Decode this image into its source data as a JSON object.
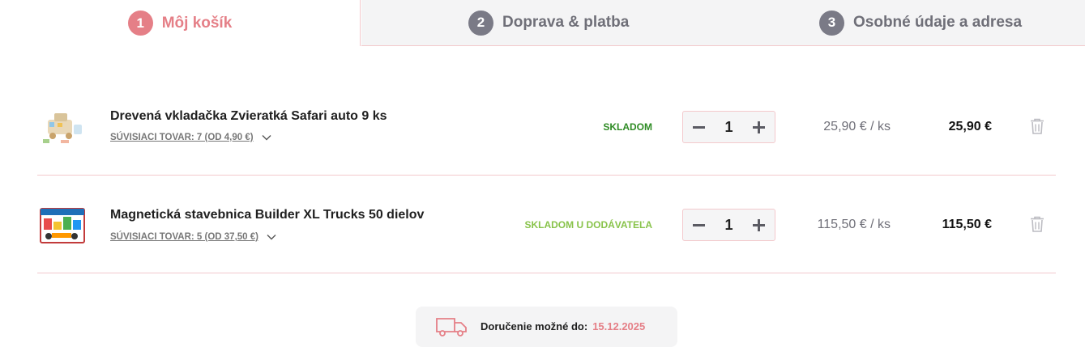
{
  "steps": [
    {
      "number": "1",
      "label": "Môj košík",
      "active": true
    },
    {
      "number": "2",
      "label": "Doprava & platba",
      "active": false
    },
    {
      "number": "3",
      "label": "Osobné údaje a adresa",
      "active": false
    }
  ],
  "colors": {
    "accent": "#e57f87",
    "step_inactive": "#7a7a86",
    "in_stock": "#2e8b24",
    "supplier_stock": "#88c34a",
    "divider": "#f3c9cc"
  },
  "items": [
    {
      "name": "Drevená vkladačka Zvieratká Safari auto 9 ks",
      "related": "SÚVISIACI TOVAR: 7 (OD 4,90 €)",
      "stock": "SKLADOM",
      "quantity": "1",
      "unit_price": "25,90 €  / ks",
      "total": "25,90 €"
    },
    {
      "name": "Magnetická stavebnica Builder XL Trucks 50 dielov",
      "related": "SÚVISIACI TOVAR: 5 (OD 37,50 €)",
      "stock": "SKLADOM U DODÁVATEĽA",
      "quantity": "1",
      "unit_price": "115,50 €  / ks",
      "total": "115,50 €"
    }
  ],
  "icons": {
    "qty_minus": "minus-icon",
    "qty_plus": "plus-icon",
    "remove": "trash-icon",
    "related_toggle": "chevron-down-icon",
    "delivery": "truck-icon"
  },
  "delivery": {
    "label": "Doručenie možné do:",
    "date": "15.12.2025"
  }
}
